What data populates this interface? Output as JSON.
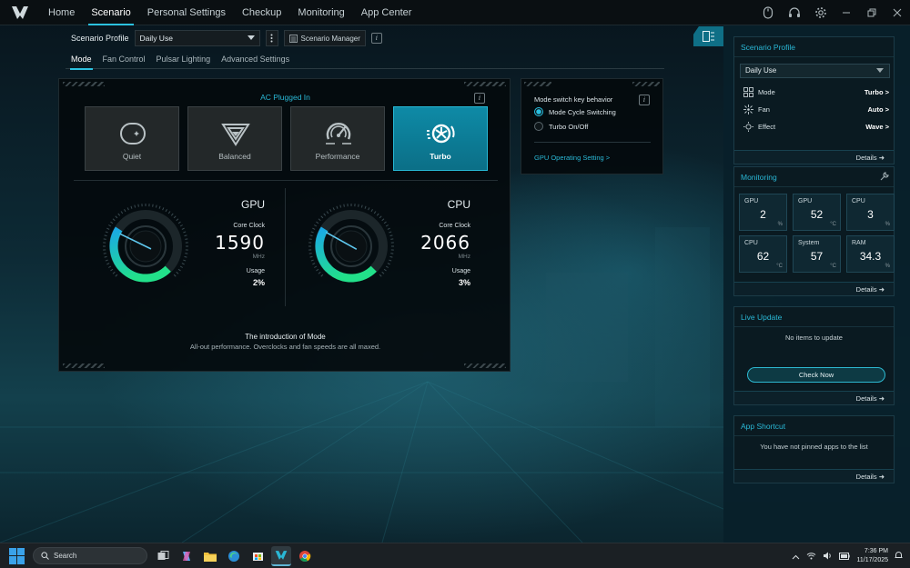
{
  "nav": {
    "tabs": [
      "Home",
      "Scenario",
      "Personal Settings",
      "Checkup",
      "Monitoring",
      "App Center"
    ],
    "active_index": 1
  },
  "profile_bar": {
    "label": "Scenario Profile",
    "selected": "Daily Use",
    "manager_label": "Scenario Manager",
    "info_glyph": "i"
  },
  "subtabs": {
    "items": [
      "Mode",
      "Fan Control",
      "Pulsar Lighting",
      "Advanced Settings"
    ],
    "active_index": 0
  },
  "mode_panel": {
    "power_status": "AC Plugged In",
    "info_glyph": "i",
    "modes": [
      {
        "label": "Quiet",
        "icon": "quiet-mode-icon",
        "selected": false
      },
      {
        "label": "Balanced",
        "icon": "balanced-mode-icon",
        "selected": false
      },
      {
        "label": "Performance",
        "icon": "performance-mode-icon",
        "selected": false
      },
      {
        "label": "Turbo",
        "icon": "turbo-mode-icon",
        "selected": true
      }
    ],
    "gpu": {
      "title": "GPU",
      "clock_label": "Core Clock",
      "clock": "1590",
      "clock_unit": "MHz",
      "usage_label": "Usage",
      "usage": "2%",
      "usage_fraction": 0.02
    },
    "cpu": {
      "title": "CPU",
      "clock_label": "Core Clock",
      "clock": "2066",
      "clock_unit": "MHz",
      "usage_label": "Usage",
      "usage": "3%",
      "usage_fraction": 0.03
    },
    "intro_title": "The introduction of Mode",
    "intro_text": "All-out performance. Overclocks and fan speeds are all maxed."
  },
  "key_panel": {
    "title": "Mode switch key behavior",
    "info_glyph": "i",
    "options": [
      {
        "label": "Mode Cycle Switching",
        "checked": true
      },
      {
        "label": "Turbo On/Off",
        "checked": false
      }
    ],
    "link": "GPU Operating Setting >"
  },
  "sidebar": {
    "scenario_card": {
      "title": "Scenario Profile",
      "selected": "Daily Use",
      "rows": [
        {
          "icon": "mode-grid-icon",
          "label": "Mode",
          "value": "Turbo >"
        },
        {
          "icon": "fan-icon",
          "label": "Fan",
          "value": "Auto >"
        },
        {
          "icon": "effect-sun-icon",
          "label": "Effect",
          "value": "Wave >"
        }
      ],
      "details": "Details"
    },
    "monitoring_card": {
      "title": "Monitoring",
      "cells": [
        {
          "label": "GPU",
          "value": "2",
          "unit": "%"
        },
        {
          "label": "GPU",
          "value": "52",
          "unit": "°C"
        },
        {
          "label": "CPU",
          "value": "3",
          "unit": "%"
        },
        {
          "label": "CPU",
          "value": "62",
          "unit": "°C"
        },
        {
          "label": "System",
          "value": "57",
          "unit": "°C"
        },
        {
          "label": "RAM",
          "value": "34.3",
          "unit": "%"
        }
      ],
      "details": "Details"
    },
    "live_update_card": {
      "title": "Live Update",
      "empty_text": "No items to update",
      "button": "Check Now",
      "details": "Details"
    },
    "app_shortcut_card": {
      "title": "App Shortcut",
      "empty_text": "You have not pinned apps to the list",
      "details": "Details"
    }
  },
  "taskbar": {
    "search_placeholder": "Search",
    "time": "7:36 PM",
    "date": "11/17/2025"
  },
  "colors": {
    "accent": "#2ab8d6",
    "turbo": "#0e8aa6",
    "gauge_start": "#1aa8e6",
    "gauge_end": "#22e08a"
  }
}
